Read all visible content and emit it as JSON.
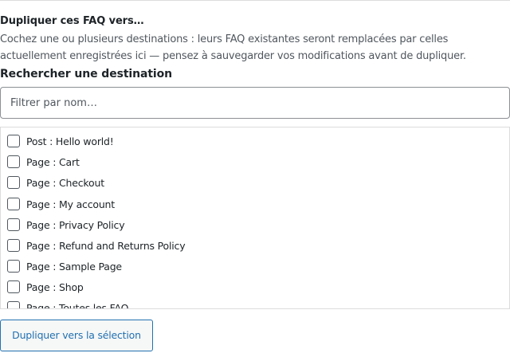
{
  "section": {
    "heading": "Dupliquer ces FAQ vers…",
    "description": "Cochez une ou plusieurs destinations : leurs FAQ existantes seront remplacées par celles actuellement enregistrées ici — pensez à sauvegarder vos modifications avant de dupliquer."
  },
  "search": {
    "label": "Rechercher une destination",
    "placeholder": "Filtrer par nom…",
    "value": ""
  },
  "destinations": {
    "items": [
      {
        "label": "Post : Hello world!",
        "checked": false
      },
      {
        "label": "Page : Cart",
        "checked": false
      },
      {
        "label": "Page : Checkout",
        "checked": false
      },
      {
        "label": "Page : My account",
        "checked": false
      },
      {
        "label": "Page : Privacy Policy",
        "checked": false
      },
      {
        "label": "Page : Refund and Returns Policy",
        "checked": false
      },
      {
        "label": "Page : Sample Page",
        "checked": false
      },
      {
        "label": "Page : Shop",
        "checked": false
      },
      {
        "label": "Page : Toutes les FAQ",
        "checked": false
      }
    ]
  },
  "actions": {
    "duplicate_label": "Dupliquer vers la sélection"
  },
  "colors": {
    "accent": "#2271b1",
    "text": "#1d2327",
    "muted_text": "#50575e",
    "border": "#dcdcde"
  }
}
